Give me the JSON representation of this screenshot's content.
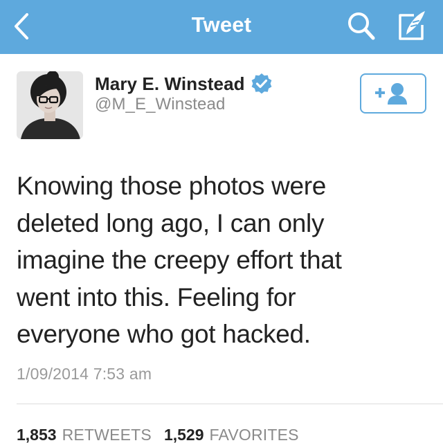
{
  "header": {
    "title": "Tweet",
    "back_icon": "chevron-left-icon",
    "search_icon": "search-icon",
    "compose_icon": "compose-icon",
    "background_color": "#5ea9dd"
  },
  "author": {
    "name": "Mary E. Winstead",
    "handle": "@M_E_Winstead",
    "verified": true,
    "verified_color": "#5ea9dd",
    "follow_icon": "follow-user-icon"
  },
  "tweet": {
    "lines": [
      "Knowing those photos were",
      "deleted long ago, I can only",
      "imagine the creepy effort that",
      "went into this. Feeling for",
      "everyone who got hacked."
    ],
    "timestamp": "1/09/2014 7:53 am"
  },
  "stats": {
    "retweets_count": "1,853",
    "retweets_label": "RETWEETS",
    "favorites_count": "1,529",
    "favorites_label": "FAVORITES"
  }
}
